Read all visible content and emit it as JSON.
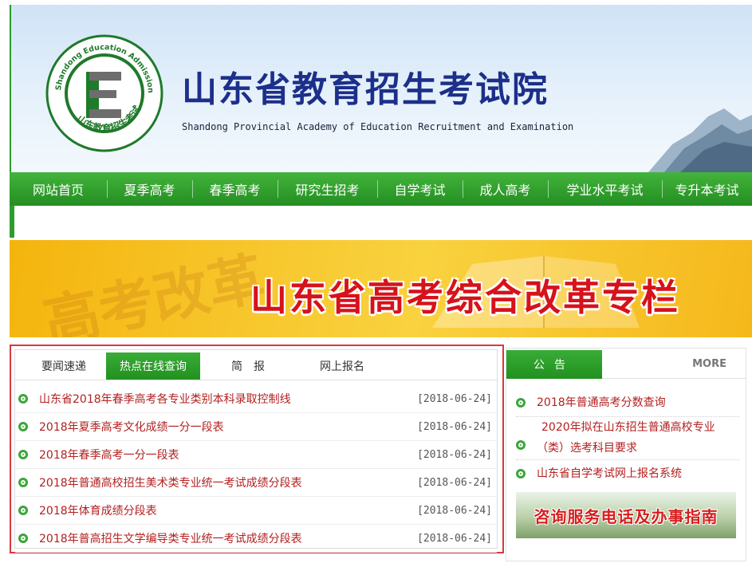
{
  "header": {
    "title_cn": "山东省教育招生考试院",
    "title_en": "Shandong Provincial Academy of Education  Recruitment and Examination",
    "seal_ring_text_en": "Shandong Education Admissions & Examinations",
    "seal_ring_text_cn": "山东教育招生考试",
    "seal_letter": "E"
  },
  "nav": {
    "items": [
      {
        "label": "网站首页",
        "w": 122
      },
      {
        "label": "夏季高考",
        "w": 107
      },
      {
        "label": "春季高考",
        "w": 107
      },
      {
        "label": "研究生招考",
        "w": 125
      },
      {
        "label": "自学考试",
        "w": 107
      },
      {
        "label": "成人高考",
        "w": 107
      },
      {
        "label": "学业水平考试",
        "w": 143
      },
      {
        "label": "专升本考试",
        "w": 113
      }
    ]
  },
  "banner": {
    "title": "山东省高考综合改革专栏"
  },
  "news": {
    "tabs": [
      "要闻速递",
      "热点在线查询",
      "简　报",
      "网上报名"
    ],
    "active_tab": 1,
    "items": [
      {
        "title": "山东省2018年春季高考各专业类别本科录取控制线",
        "date": "[2018-06-24]"
      },
      {
        "title": "2018年夏季高考文化成绩一分一段表",
        "date": "[2018-06-24]"
      },
      {
        "title": "2018年春季高考一分一段表",
        "date": "[2018-06-24]"
      },
      {
        "title": "2018年普通高校招生美术类专业统一考试成绩分段表",
        "date": "[2018-06-24]"
      },
      {
        "title": "2018年体育成绩分段表",
        "date": "[2018-06-24]"
      },
      {
        "title": "2018年普高招生文学编导类专业统一考试成绩分段表",
        "date": "[2018-06-24]"
      }
    ]
  },
  "notice": {
    "tab_label": "公告",
    "more_label": "MORE",
    "items": [
      {
        "title": "2018年普通高考分数查询"
      },
      {
        "title": "2020年拟在山东招生普通高校专业（类）选考科目要求"
      },
      {
        "title": "山东省自学考试网上报名系统"
      }
    ],
    "hotline_label": "咨询服务电话及办事指南"
  },
  "colors": {
    "nav_green": "#2f9d2b",
    "title_blue": "#1c2f8a",
    "link_red": "#b32020",
    "panel_border_red": "#d8383f",
    "banner_title_red": "#d6121b"
  }
}
